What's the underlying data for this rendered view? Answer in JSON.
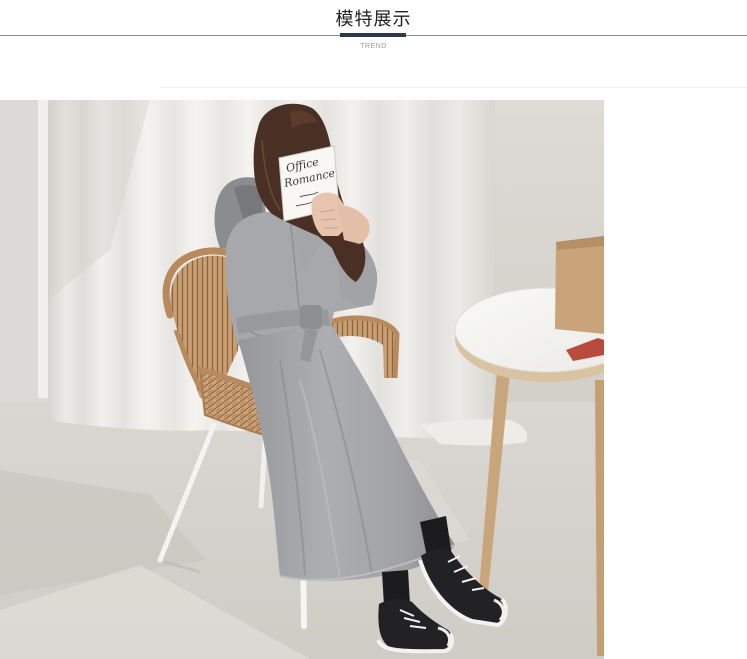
{
  "section": {
    "title": "模特展示",
    "subtitle": "TREND"
  },
  "photo": {
    "book_cover_lines": [
      "Office",
      "Romance"
    ]
  },
  "colors": {
    "title_text": "#1f1f1f",
    "accent_underline": "#2c3a4b",
    "divider": "#8e8e8e",
    "subtitle_text": "#9a9a9a",
    "background": "#ffffff"
  }
}
